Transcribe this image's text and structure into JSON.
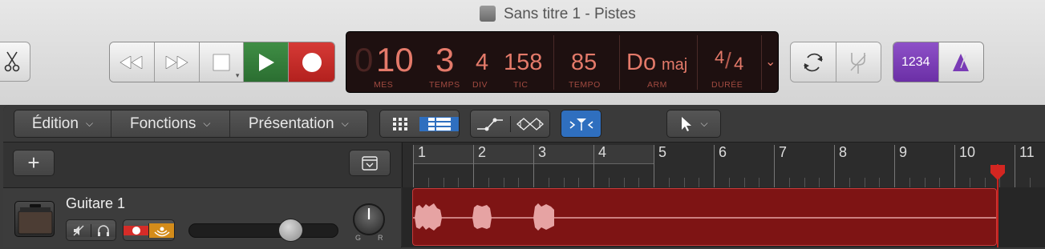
{
  "window": {
    "title": "Sans titre 1 - Pistes"
  },
  "transport": {
    "rewind_icon": "rewind-icon",
    "fastforward_icon": "fast-forward-icon",
    "stop_icon": "stop-icon",
    "play_icon": "play-icon",
    "record_icon": "record-icon"
  },
  "lcd": {
    "bar_ghost": "0",
    "bar": "10",
    "beat": "3",
    "div": "4",
    "tick": "158",
    "tempo": "85",
    "key_note": "Do",
    "key_mode": "maj",
    "sig_num": "4",
    "sig_den": "4",
    "labels": {
      "bar": "MES",
      "beat": "TEMPS",
      "div": "DIV",
      "tick": "TIC",
      "tempo": "TEMPO",
      "key": "ARM",
      "sig": "DURÉE"
    }
  },
  "countin": {
    "label": "1234"
  },
  "menus": {
    "edit": "Édition",
    "functions": "Fonctions",
    "view": "Présentation"
  },
  "ruler": {
    "bars": [
      "1",
      "2",
      "3",
      "4",
      "5",
      "6",
      "7",
      "8",
      "9",
      "10",
      "11"
    ]
  },
  "track": {
    "name": "Guitare 1",
    "pan_left": "G",
    "pan_right": "R",
    "volume_fraction": 0.72
  },
  "colors": {
    "play": "#2f7d35",
    "record": "#c7221f",
    "accent_blue": "#2f6fbf",
    "region": "#7e1414",
    "countin": "#7a3bb6"
  }
}
